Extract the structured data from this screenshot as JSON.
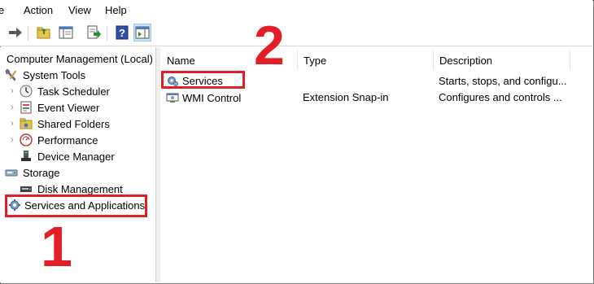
{
  "menu": {
    "file_partial": "e",
    "action": "Action",
    "view": "View",
    "help": "Help"
  },
  "toolbar": {
    "icons": [
      "forward-arrow-icon",
      "up-folder-icon",
      "show-hide-console-tree-icon",
      "export-list-icon",
      "help-icon",
      "show-action-pane-icon"
    ]
  },
  "tree": {
    "root": "Computer Management (Local)",
    "items": [
      {
        "label": "System Tools",
        "icon": "system-tools-icon"
      },
      {
        "label": "Task Scheduler",
        "icon": "clock-icon"
      },
      {
        "label": "Event Viewer",
        "icon": "event-viewer-icon"
      },
      {
        "label": "Shared Folders",
        "icon": "shared-folder-icon"
      },
      {
        "label": "Performance",
        "icon": "performance-icon"
      },
      {
        "label": "Device Manager",
        "icon": "device-manager-icon"
      },
      {
        "label": "Storage",
        "icon": "storage-icon"
      },
      {
        "label": "Disk Management",
        "icon": "disk-icon"
      },
      {
        "label": "Services and Applications",
        "icon": "gear-icon"
      }
    ]
  },
  "list": {
    "columns": [
      "Name",
      "Type",
      "Description"
    ],
    "rows": [
      {
        "name": "Services",
        "type": "",
        "description": "Starts, stops, and configu..."
      },
      {
        "name": "WMI Control",
        "type": "Extension Snap-in",
        "description": "Configures and controls ..."
      }
    ]
  },
  "annotations": {
    "step1": "1",
    "step2": "2",
    "color": "#e41e26"
  }
}
